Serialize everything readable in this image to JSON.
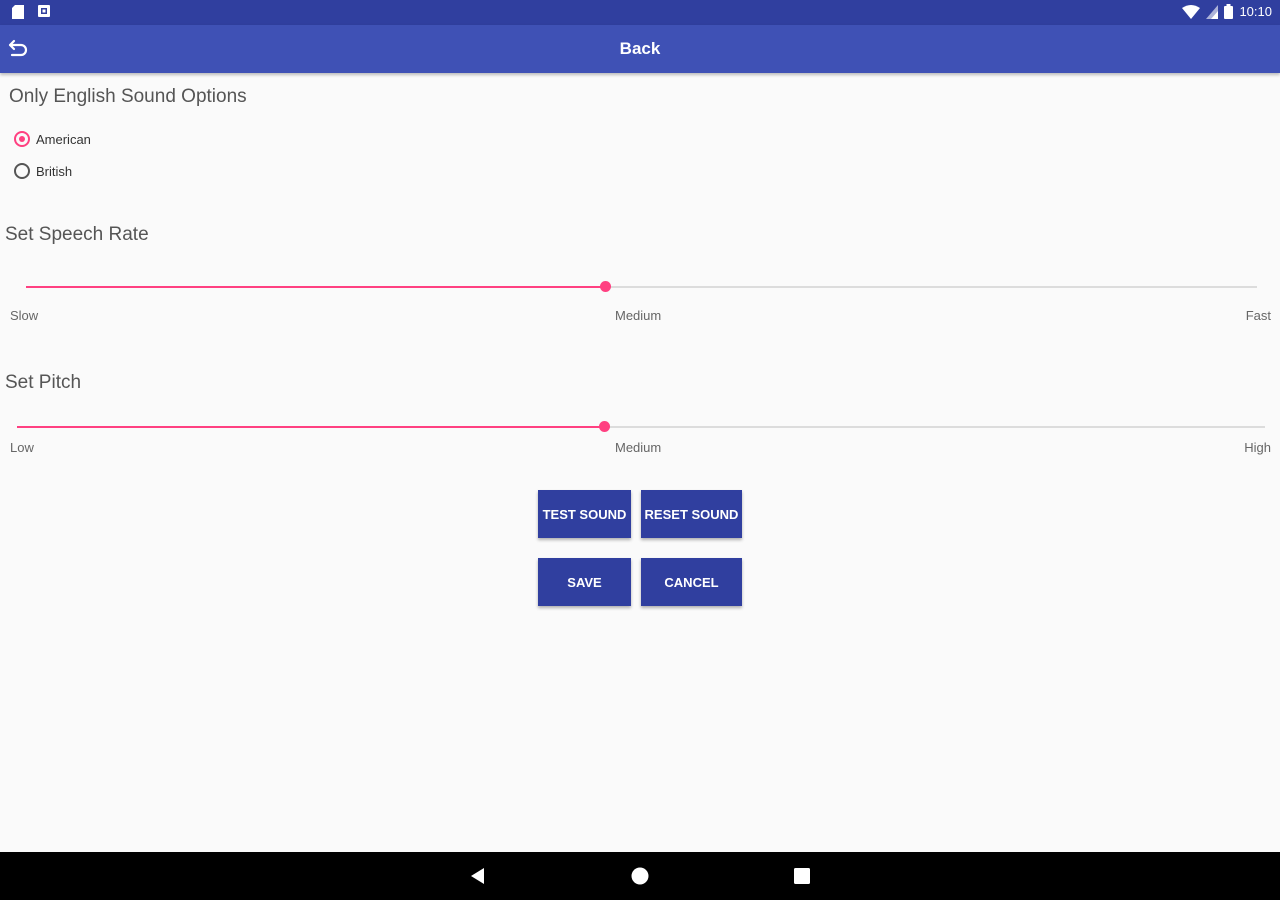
{
  "status_bar": {
    "time": "10:10",
    "icons": [
      "sd-card-icon",
      "notification-icon",
      "wifi-icon",
      "signal-icon",
      "battery-icon"
    ]
  },
  "app_bar": {
    "title": "Back",
    "back_icon": "undo-arrow-icon"
  },
  "sound_options": {
    "title": "Only English Sound Options",
    "options": [
      {
        "label": "American",
        "selected": true
      },
      {
        "label": "British",
        "selected": false
      }
    ]
  },
  "speech_rate": {
    "title": "Set Speech Rate",
    "min_label": "Slow",
    "mid_label": "Medium",
    "max_label": "Fast",
    "value_fraction": 0.47
  },
  "pitch": {
    "title": "Set Pitch",
    "min_label": "Low",
    "mid_label": "Medium",
    "max_label": "High",
    "value_fraction": 0.47
  },
  "buttons": {
    "test_sound": "TEST SOUND",
    "reset_sound": "RESET SOUND",
    "save": "SAVE",
    "cancel": "CANCEL"
  },
  "colors": {
    "status_bar": "#303f9f",
    "app_bar": "#3f51b5",
    "accent": "#ff4081",
    "button": "#303f9f"
  },
  "nav_bar": {
    "icons": [
      "back-triangle-icon",
      "home-circle-icon",
      "recents-square-icon"
    ]
  }
}
